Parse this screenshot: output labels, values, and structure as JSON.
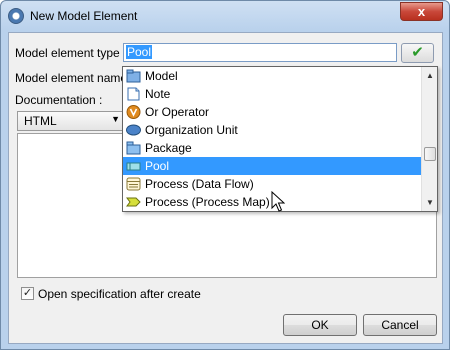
{
  "window": {
    "title": "New Model Element",
    "close_glyph": "x"
  },
  "form": {
    "type_label": "Model element type :",
    "type_value": "Pool",
    "name_label": "Model element name :",
    "documentation_label": "Documentation :",
    "doc_format": "HTML",
    "confirm_icon": "checkmark-icon"
  },
  "dropdown": {
    "items": [
      {
        "label": "Model",
        "icon": "model-icon"
      },
      {
        "label": "Note",
        "icon": "note-icon"
      },
      {
        "label": "Or Operator",
        "icon": "or-operator-icon"
      },
      {
        "label": "Organization Unit",
        "icon": "organization-unit-icon"
      },
      {
        "label": "Package",
        "icon": "package-icon"
      },
      {
        "label": "Pool",
        "icon": "pool-icon",
        "selected": true
      },
      {
        "label": "Process (Data Flow)",
        "icon": "process-data-flow-icon"
      },
      {
        "label": "Process (Process Map)",
        "icon": "process-map-icon"
      }
    ],
    "scroll_up": "▲",
    "scroll_down": "▼"
  },
  "options": {
    "open_spec_label": "Open specification after create",
    "open_spec_checked": true
  },
  "buttons": {
    "ok": "OK",
    "cancel": "Cancel"
  },
  "colors": {
    "selection": "#3399ff",
    "title_gradient_top": "#cfe0f3",
    "close_red": "#c9483a"
  }
}
